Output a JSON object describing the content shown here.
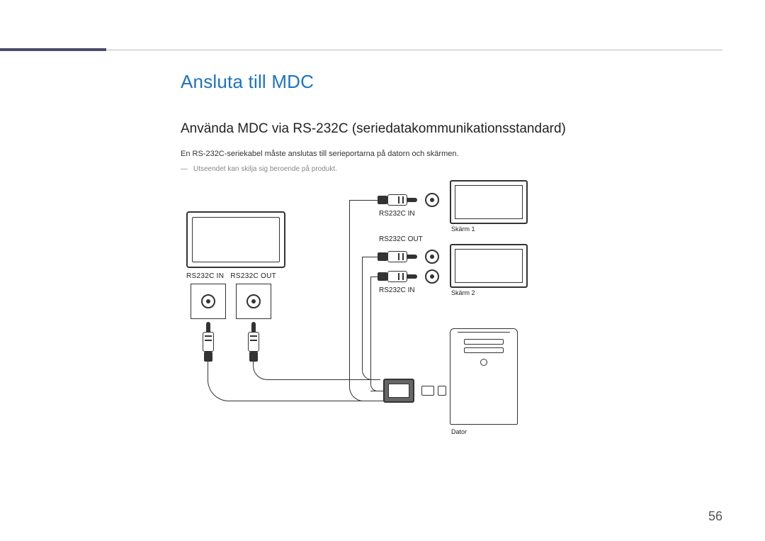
{
  "page": {
    "title": "Ansluta till MDC",
    "subtitle": "Använda MDC via RS-232C (seriedatakommunikationsstandard)",
    "body": "En RS-232C-seriekabel måste anslutas till serieportarna på datorn och skärmen.",
    "note": "Utseendet kan skilja sig beroende på produkt.",
    "page_number": "56"
  },
  "diagram": {
    "left_ports": {
      "in": "RS232C IN",
      "out": "RS232C OUT"
    },
    "right_labels": {
      "in_top": "RS232C IN",
      "out": "RS232C OUT",
      "in_bottom": "RS232C IN"
    },
    "screen1": "Skärm 1",
    "screen2": "Skärm 2",
    "computer": "Dator"
  }
}
